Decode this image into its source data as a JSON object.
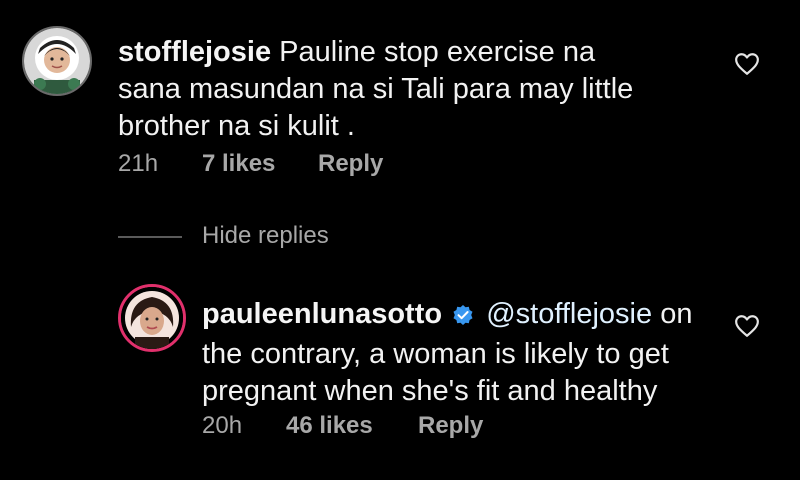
{
  "comments": [
    {
      "username": "stofflejosie",
      "text": "Pauline stop exercise na sana masundan na si Tali para may little brother na si kulit .",
      "time": "21h",
      "likes": "7 likes",
      "reply_label": "Reply",
      "avatar_icon": "user-avatar-icon"
    }
  ],
  "hide_replies_label": "Hide replies",
  "replies": [
    {
      "username": "pauleenlunasotto",
      "verified": true,
      "mention": "@stofflejosie",
      "text": "on the contrary, a woman is likely to get pregnant when she's fit and healthy",
      "time": "20h",
      "likes": "46 likes",
      "reply_label": "Reply",
      "avatar_icon": "user-avatar-icon"
    }
  ],
  "colors": {
    "background": "#000000",
    "text": "#f2f2f2",
    "meta": "#a8a8a8",
    "verified_badge": "#3897f0",
    "mention": "#e0f1ff",
    "story_ring": "#e1306c"
  }
}
